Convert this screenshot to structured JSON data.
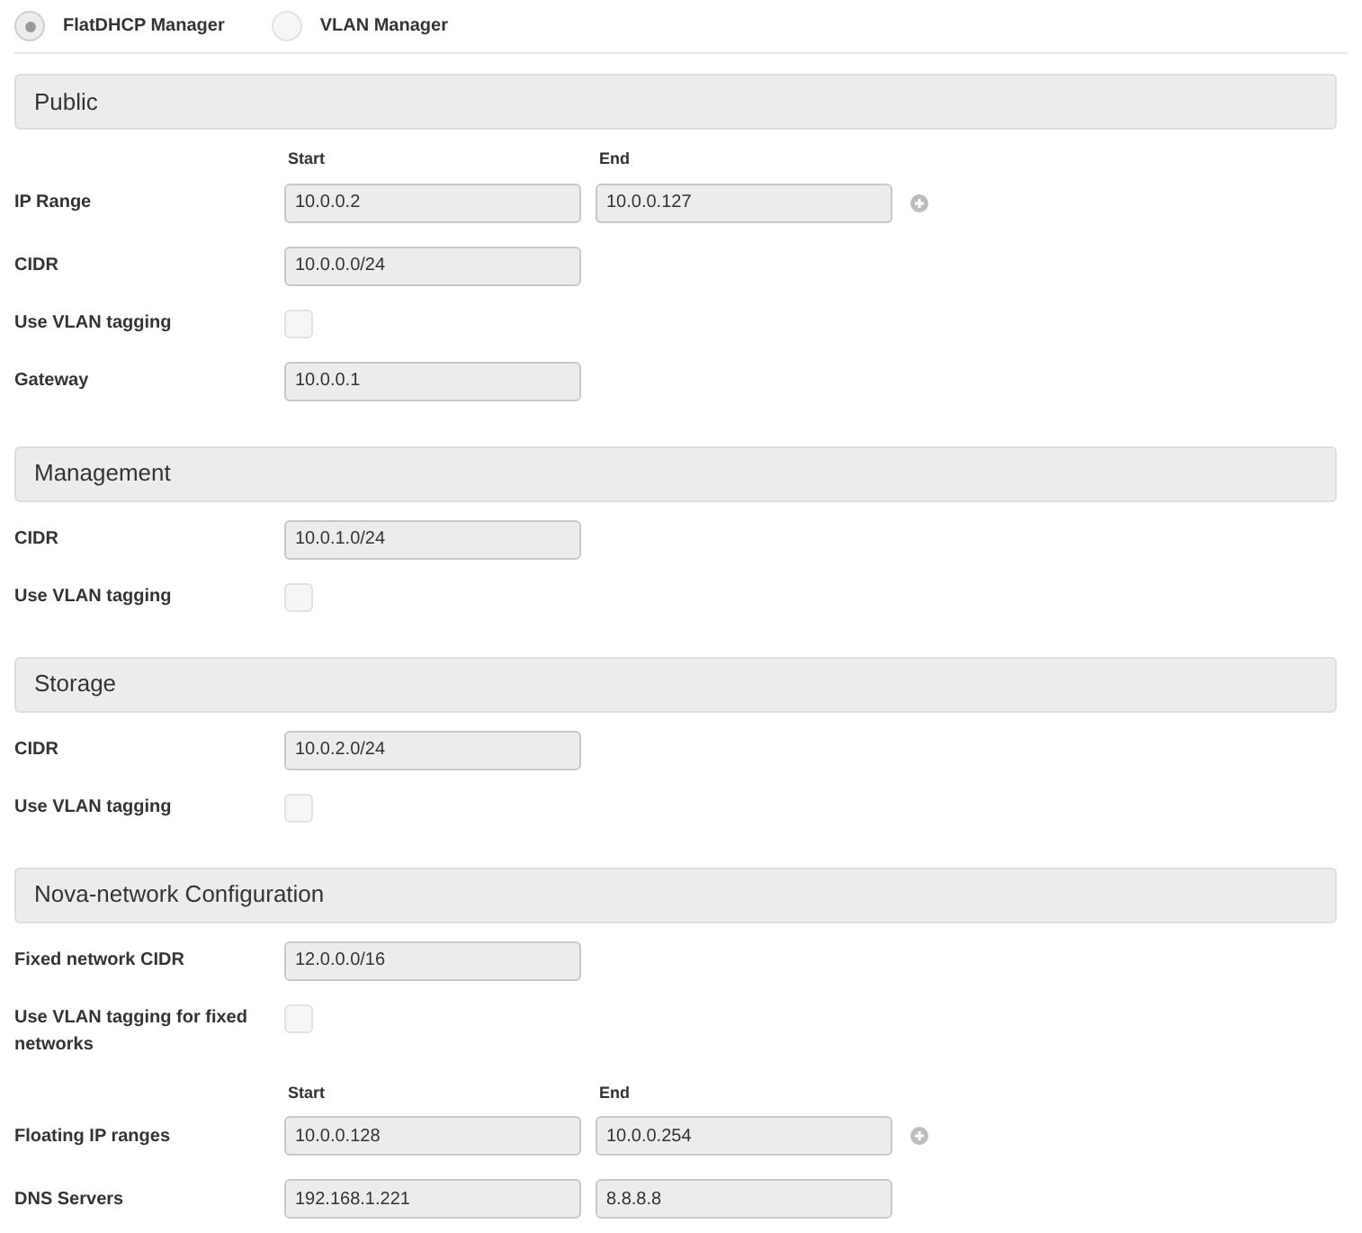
{
  "managers": [
    {
      "label": "FlatDHCP Manager",
      "selected": true
    },
    {
      "label": "VLAN Manager",
      "selected": false
    }
  ],
  "sections": [
    {
      "title": "Public",
      "rows": [
        {
          "kind": "range",
          "label": "IP Range",
          "start_label": "Start",
          "end_label": "End",
          "start": "10.0.0.2",
          "end": "10.0.0.127"
        },
        {
          "kind": "text",
          "label": "CIDR",
          "value": "10.0.0.0/24"
        },
        {
          "kind": "checkbox",
          "label": "Use VLAN tagging",
          "checked": false
        },
        {
          "kind": "text",
          "label": "Gateway",
          "value": "10.0.0.1"
        }
      ]
    },
    {
      "title": "Management",
      "rows": [
        {
          "kind": "text",
          "label": "CIDR",
          "value": "10.0.1.0/24"
        },
        {
          "kind": "checkbox",
          "label": "Use VLAN tagging",
          "checked": false
        }
      ]
    },
    {
      "title": "Storage",
      "rows": [
        {
          "kind": "text",
          "label": "CIDR",
          "value": "10.0.2.0/24"
        },
        {
          "kind": "checkbox",
          "label": "Use VLAN tagging",
          "checked": false
        }
      ]
    },
    {
      "title": "Nova-network Configuration",
      "rows": [
        {
          "kind": "text",
          "label": "Fixed network CIDR",
          "value": "12.0.0.0/16"
        },
        {
          "kind": "checkbox",
          "label": "Use VLAN tagging for fixed networks",
          "checked": false
        },
        {
          "kind": "range",
          "label": "Floating IP ranges",
          "start_label": "Start",
          "end_label": "End",
          "start": "10.0.0.128",
          "end": "10.0.0.254"
        },
        {
          "kind": "pair",
          "label": "DNS Servers",
          "start": "192.168.1.221",
          "end": "8.8.8.8"
        }
      ]
    }
  ]
}
